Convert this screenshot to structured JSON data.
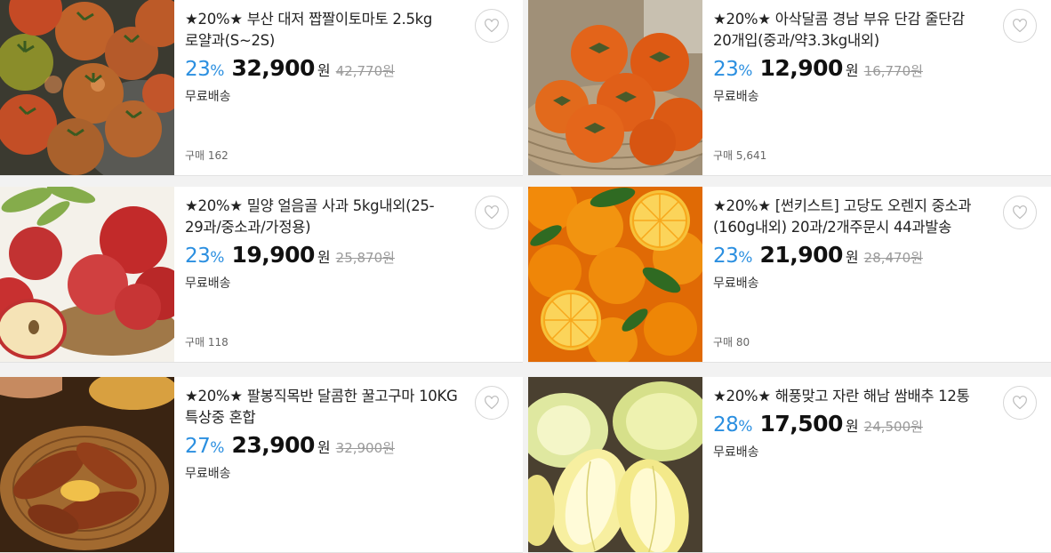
{
  "products": [
    {
      "title": "★20%★ 부산 대저 짭짤이토마토 2.5kg 로얄과(S~2S)",
      "discount": "23",
      "price": "32,900",
      "currency": "원",
      "original": "42,770원",
      "shipping": "무료배송",
      "sold": "구매 162",
      "image": "tomato-photo"
    },
    {
      "title": "★20%★ 아삭달콤 경남 부유 단감 줄단감 20개입(중과/약3.3kg내외)",
      "discount": "23",
      "price": "12,900",
      "currency": "원",
      "original": "16,770원",
      "shipping": "무료배송",
      "sold": "구매 5,641",
      "image": "persimmon-photo"
    },
    {
      "title": "★20%★ 밀양 얼음골 사과 5kg내외(25-29과/중소과/가정용)",
      "discount": "23",
      "price": "19,900",
      "currency": "원",
      "original": "25,870원",
      "shipping": "무료배송",
      "sold": "구매 118",
      "image": "apple-photo"
    },
    {
      "title": "★20%★ [썬키스트] 고당도 오렌지 중소과(160g내외) 20과/2개주문시 44과발송",
      "discount": "23",
      "price": "21,900",
      "currency": "원",
      "original": "28,470원",
      "shipping": "무료배송",
      "sold": "구매 80",
      "image": "orange-photo"
    },
    {
      "title": "★20%★ 팔봉직목반 달콤한 꿀고구마 10KG 특상중 혼합",
      "discount": "27",
      "price": "23,900",
      "currency": "원",
      "original": "32,900원",
      "shipping": "무료배송",
      "sold": "",
      "image": "sweet-potato-photo"
    },
    {
      "title": "★20%★ 해풍맞고 자란 해남 쌈배추 12통",
      "discount": "28",
      "price": "17,500",
      "currency": "원",
      "original": "24,500원",
      "shipping": "무료배송",
      "sold": "",
      "image": "cabbage-photo"
    }
  ],
  "percent_sign": "%",
  "heart_icon": "heart-outline-icon",
  "colors": {
    "discount": "#2b8fe0",
    "strike": "#9a9a9a",
    "background": "#f2f2f2"
  }
}
